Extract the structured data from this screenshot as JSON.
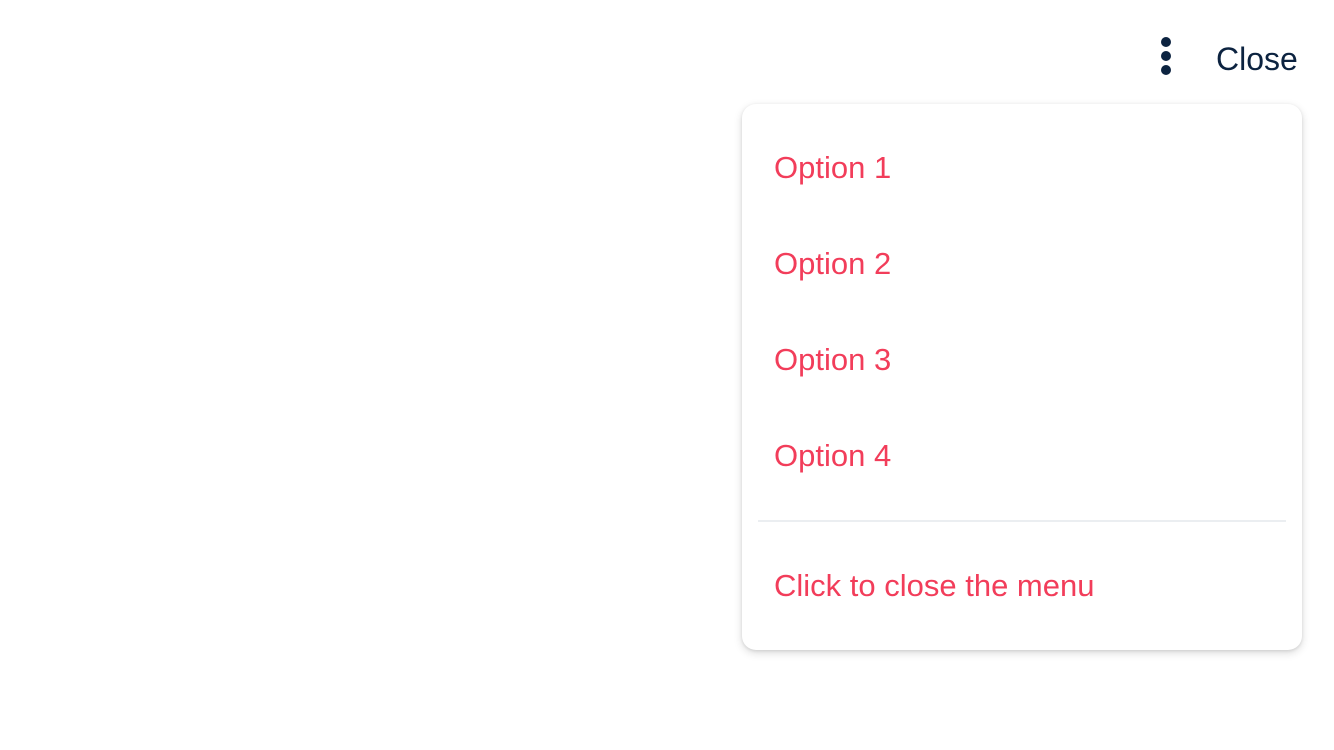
{
  "header": {
    "more_icon": "more-vert-icon",
    "close_label": "Close"
  },
  "menu": {
    "items": [
      {
        "label": "Option 1"
      },
      {
        "label": "Option 2"
      },
      {
        "label": "Option 3"
      },
      {
        "label": "Option 4"
      }
    ],
    "close_item_label": "Click to close the menu"
  },
  "colors": {
    "text_dark": "#0c2340",
    "accent": "#f23d5a",
    "divider": "#ebeef1",
    "background": "#ffffff"
  }
}
